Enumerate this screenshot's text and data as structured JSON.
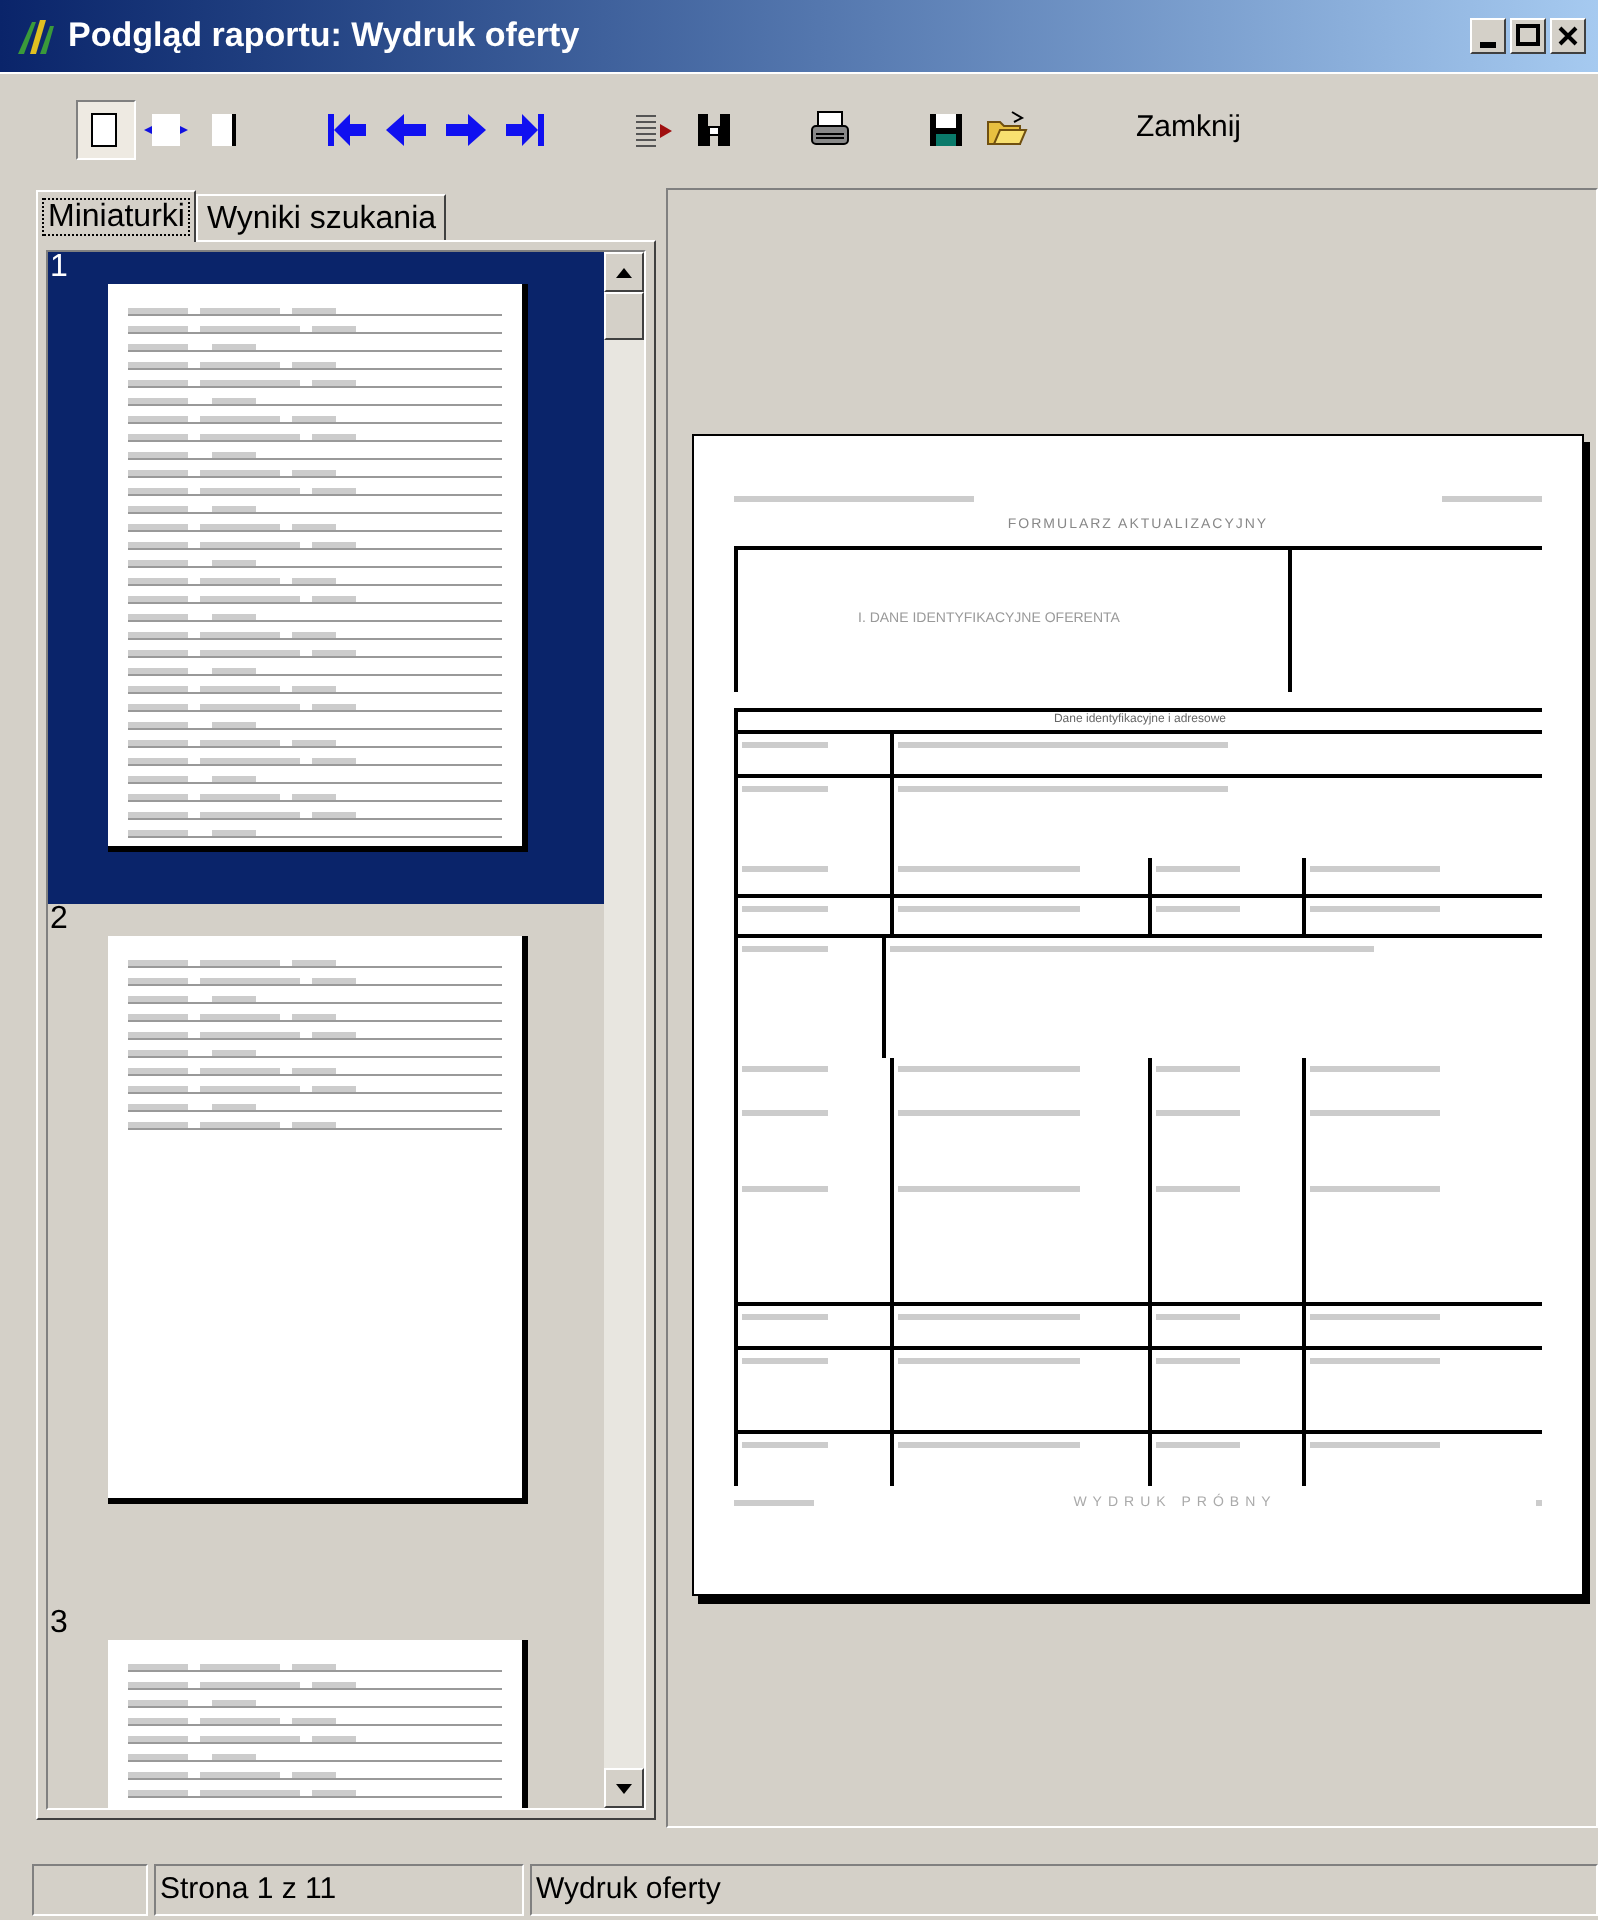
{
  "window": {
    "title": "Podgląd raportu: Wydruk oferty"
  },
  "toolbar": {
    "close_label": "Zamknij"
  },
  "tabs": [
    {
      "label": "Miniaturki",
      "selected": true
    },
    {
      "label": "Wyniki szukania",
      "selected": false
    }
  ],
  "thumbnails": [
    {
      "number": "1",
      "selected": true
    },
    {
      "number": "2",
      "selected": false
    },
    {
      "number": "3",
      "selected": false
    }
  ],
  "page": {
    "title": "FORMULARZ AKTUALIZACYJNY",
    "section": "I. DANE IDENTYFIKACYJNE OFERENTA",
    "subheading": "Dane identyfikacyjne i adresowe",
    "watermark": "WYDRUK PRÓBNY"
  },
  "status_bar": {
    "page": "Strona 1 z 11",
    "report": "Wydruk oferty"
  }
}
